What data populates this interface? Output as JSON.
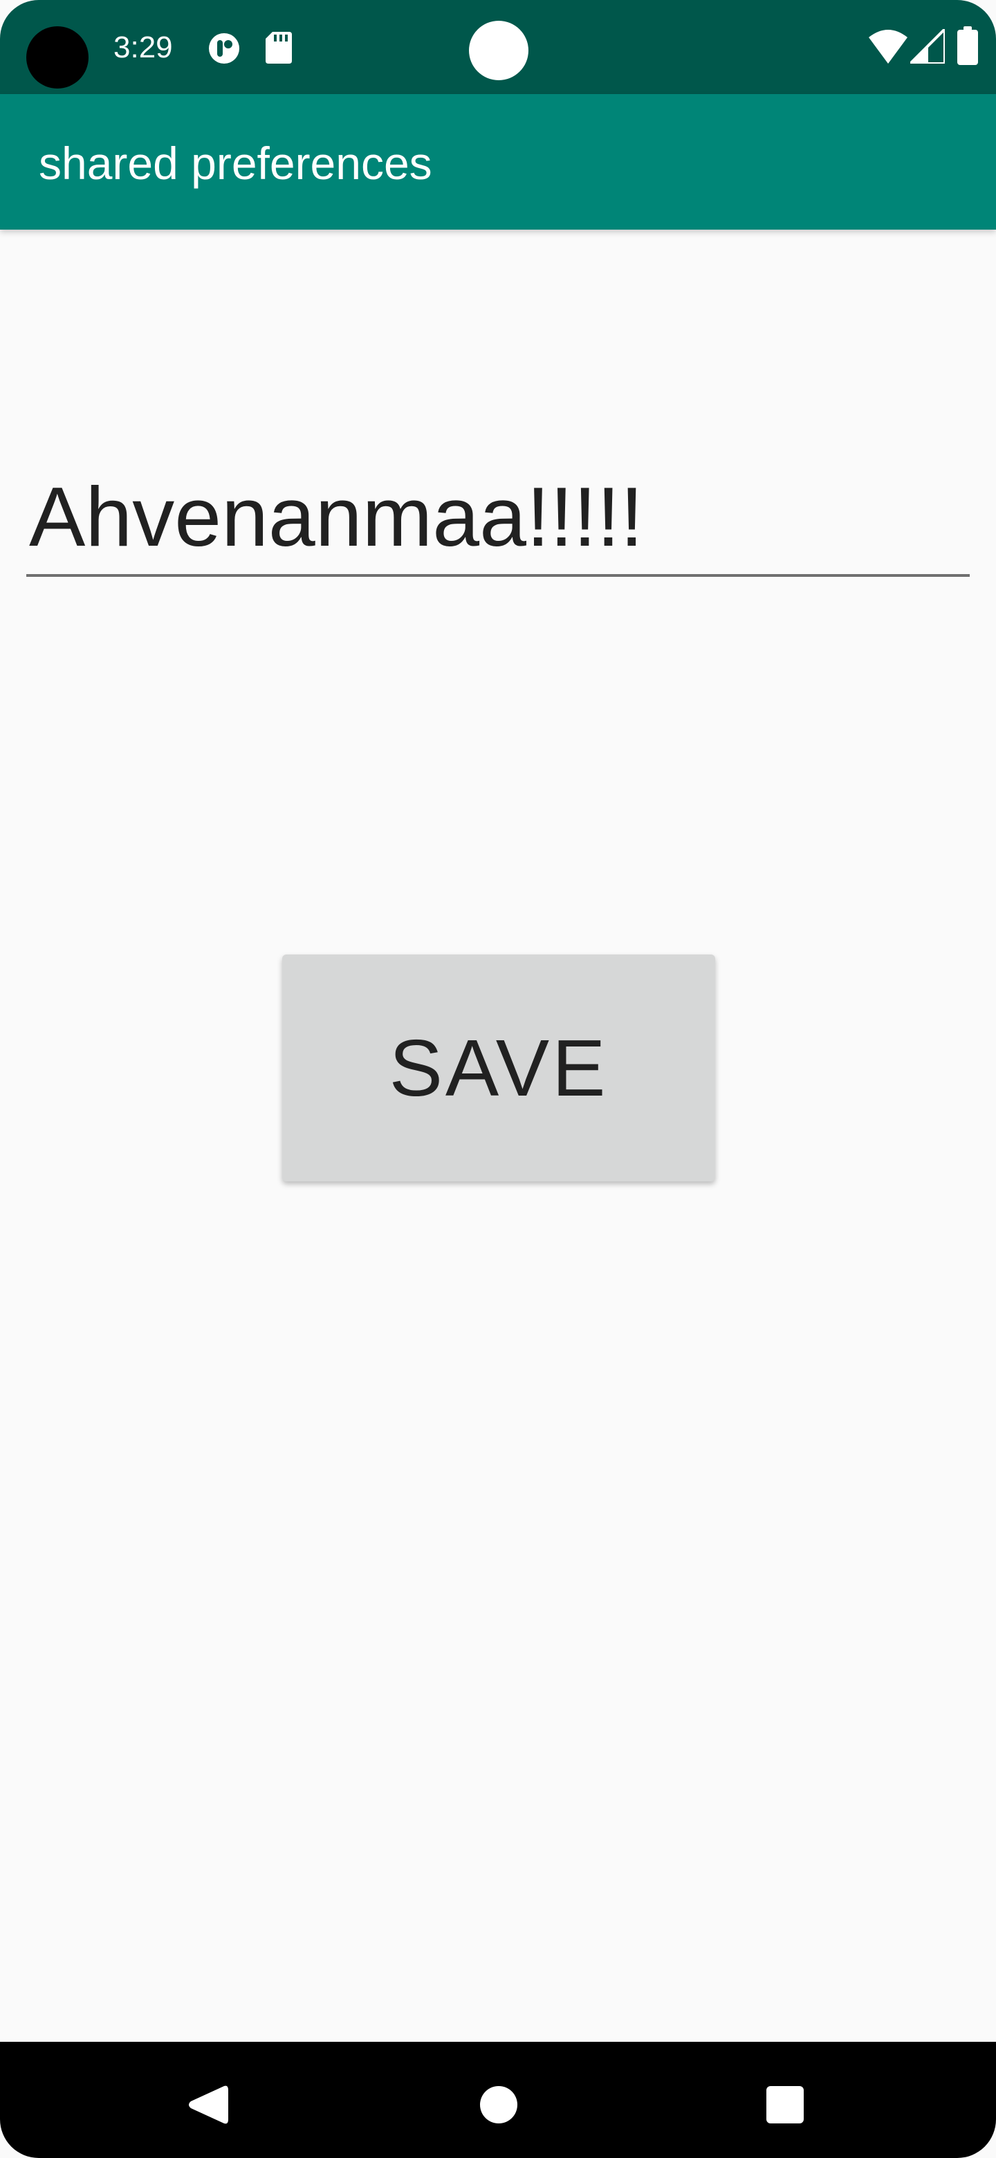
{
  "status_bar": {
    "time": "3:29",
    "icons": [
      "assistant-icon",
      "sd-card-icon",
      "wifi-icon",
      "cell-signal-icon",
      "battery-icon"
    ],
    "background_color": "#00574b"
  },
  "app_bar": {
    "title": "shared preferences",
    "background_color": "#008577"
  },
  "main": {
    "input_value": "Ahvenanmaa!!!!!",
    "save_label": "SAVE"
  },
  "nav_bar": {
    "icons": [
      "back-icon",
      "home-icon",
      "recents-icon"
    ]
  }
}
